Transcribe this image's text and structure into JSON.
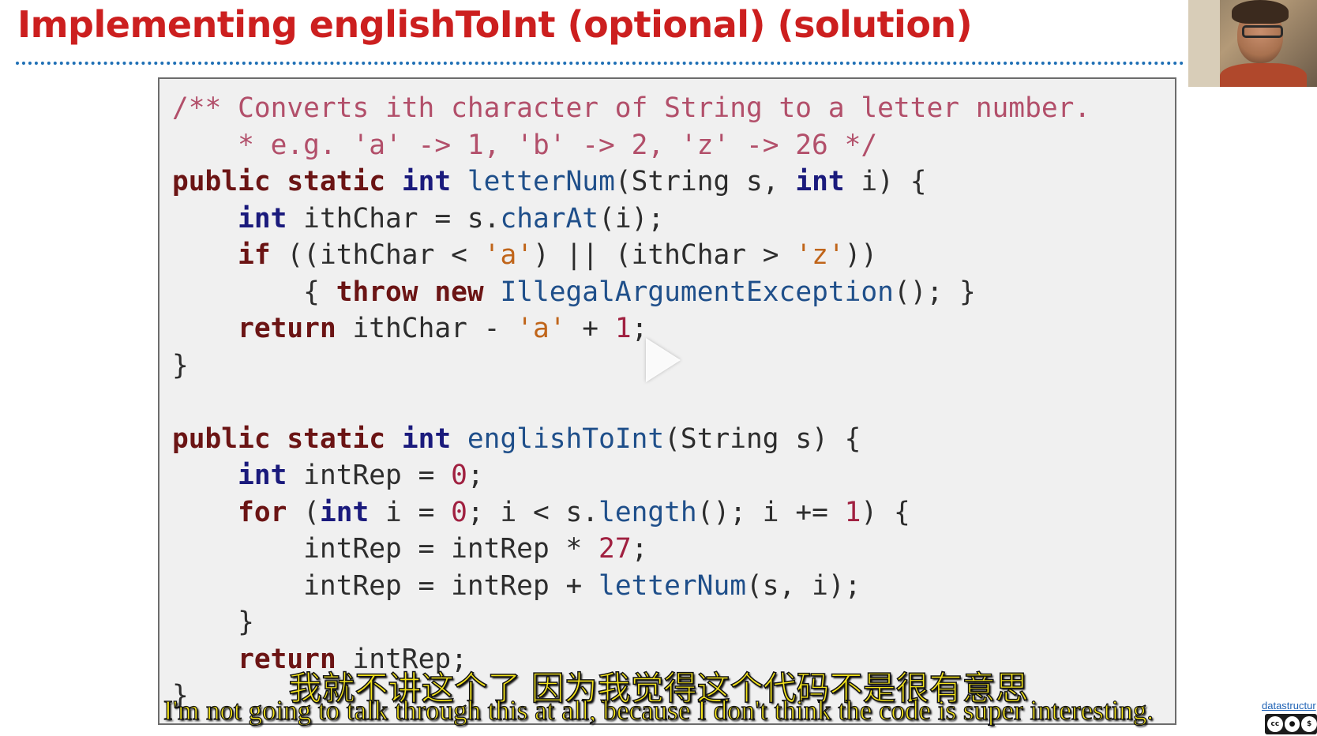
{
  "slide": {
    "title": "Implementing englishToInt (optional) (solution)"
  },
  "code": {
    "comment_line1": "/** Converts ith character of String to a letter number.",
    "comment_line2": "    * e.g. 'a' -> 1, 'b' -> 2, 'z' -> 26 */",
    "letterNum_name": "letterNum",
    "charAt_name": "charAt",
    "exception_name": "IllegalArgumentException",
    "englishToInt_name": "englishToInt",
    "length_name": "length",
    "char_a": "'a'",
    "char_z": "'z'",
    "num_zero": "0",
    "num_one": "1",
    "num_27": "27"
  },
  "subtitles": {
    "chinese": "我就不讲这个了 因为我觉得这个代码不是很有意思",
    "english": "I'm not going to talk through this at all, because I don't think the code is super interesting."
  },
  "footer": {
    "link_text": "datastructur",
    "license_icons": [
      "cc-icon",
      "by-icon",
      "nc-icon"
    ]
  },
  "colors": {
    "title": "#cc1f1f",
    "rule": "#1e6fb5",
    "comment": "#b24f6a",
    "keyword": "#6b1414",
    "type": "#1a1a7c",
    "function": "#1f4f8a",
    "char_literal": "#c0651a",
    "number": "#a02040",
    "subtitle": "#f3e31a"
  }
}
